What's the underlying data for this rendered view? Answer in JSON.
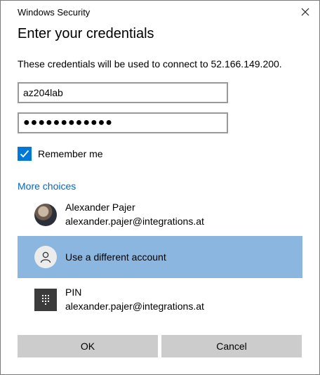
{
  "window": {
    "title": "Windows Security"
  },
  "dialog": {
    "heading": "Enter your credentials",
    "description": "These credentials will be used to connect to 52.166.149.200."
  },
  "form": {
    "username_value": "az204lab",
    "password_masked": "●●●●●●●●●●●●",
    "remember_label": "Remember me",
    "remember_checked": true
  },
  "more_choices": {
    "label": "More choices",
    "items": [
      {
        "line1": "Alexander Pajer",
        "line2": "alexander.pajer@integrations.at",
        "icon": "user-avatar-photo"
      },
      {
        "line1": "Use a different account",
        "icon": "person-icon",
        "selected": true
      },
      {
        "line1": "PIN",
        "line2": "alexander.pajer@integrations.at",
        "icon": "pin-keypad-icon"
      }
    ]
  },
  "buttons": {
    "ok": "OK",
    "cancel": "Cancel"
  },
  "colors": {
    "accent": "#0078d7",
    "link": "#0067c0",
    "selected_bg": "#8bb6e0",
    "button_bg": "#cccccc"
  }
}
